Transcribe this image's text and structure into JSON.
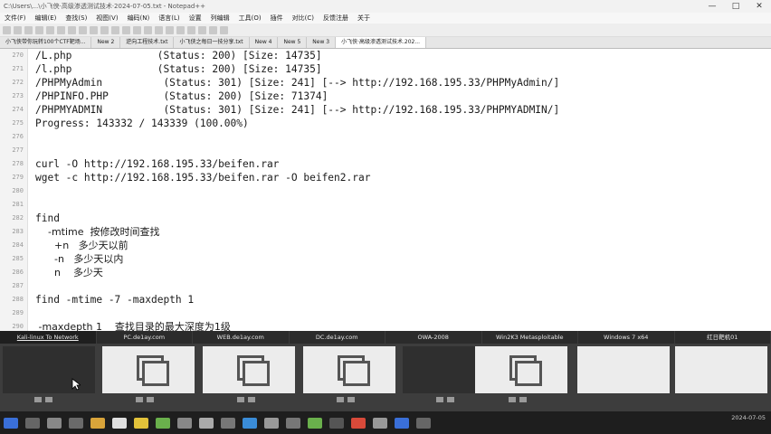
{
  "window": {
    "title": "C:\\Users\\...\\小飞侠·高级渗透测试技术·2024-07-05.txt - Notepad++",
    "controls": {
      "minimize": "—",
      "maximize": "□",
      "close": "✕"
    }
  },
  "menu": [
    "文件(F)",
    "编辑(E)",
    "查找(S)",
    "视图(V)",
    "编码(N)",
    "语言(L)",
    "设置",
    "列编辑",
    "工具(O)",
    "插件",
    "对比(C)",
    "反馈注册",
    "关于"
  ],
  "tabs": [
    {
      "label": "小飞侠带你玩转100个CTF靶场..."
    },
    {
      "label": "New 2"
    },
    {
      "label": "逆向工程技术.txt"
    },
    {
      "label": "小飞侠之每日一技分享.txt"
    },
    {
      "label": "New 4"
    },
    {
      "label": "New 5"
    },
    {
      "label": "New 3"
    },
    {
      "label": "小飞侠·高级渗透测试技术.202..."
    }
  ],
  "editor": {
    "lines": [
      {
        "n": "270",
        "text": "/L.php              (Status: 200) [Size: 14735]"
      },
      {
        "n": "271",
        "text": "/l.php              (Status: 200) [Size: 14735]"
      },
      {
        "n": "272",
        "text": "/PHPMyAdmin          (Status: 301) [Size: 241] [--> http://192.168.195.33/PHPMyAdmin/]"
      },
      {
        "n": "273",
        "text": "/PHPINFO.PHP         (Status: 200) [Size: 71374]"
      },
      {
        "n": "274",
        "text": "/PHPMYADMIN          (Status: 301) [Size: 241] [--> http://192.168.195.33/PHPMYADMIN/]"
      },
      {
        "n": "275",
        "text": "Progress: 143332 / 143339 (100.00%)"
      },
      {
        "n": "276",
        "text": ""
      },
      {
        "n": "277",
        "text": ""
      },
      {
        "n": "278",
        "text": "curl -O http://192.168.195.33/beifen.rar"
      },
      {
        "n": "279",
        "text": "wget -c http://192.168.195.33/beifen.rar -O beifen2.rar"
      },
      {
        "n": "280",
        "text": ""
      },
      {
        "n": "281",
        "text": ""
      },
      {
        "n": "282",
        "text": "find"
      },
      {
        "n": "283",
        "text": "    -mtime  按修改时间查找"
      },
      {
        "n": "284",
        "text": "      +n   多少天以前"
      },
      {
        "n": "285",
        "text": "      -n   多少天以内"
      },
      {
        "n": "286",
        "text": "      n    多少天"
      },
      {
        "n": "287",
        "text": ""
      },
      {
        "n": "288",
        "text": "find -mtime -7 -maxdepth 1"
      },
      {
        "n": "289",
        "text": ""
      },
      {
        "n": "290",
        "text": " -maxdepth 1    查找目录的最大深度为1级"
      }
    ]
  },
  "vm_tabs": [
    {
      "label": "Kali-linux To Network"
    },
    {
      "label": "PC.de1ay.com"
    },
    {
      "label": "WEB.de1ay.com"
    },
    {
      "label": "DC.de1ay.com"
    },
    {
      "label": "OWA-2008"
    },
    {
      "label": "Win2K3 Metasploitable"
    },
    {
      "label": "Windows 7 x64"
    },
    {
      "label": "红日靶机01"
    }
  ],
  "clock": {
    "time": "",
    "date": "2024-07-05"
  }
}
